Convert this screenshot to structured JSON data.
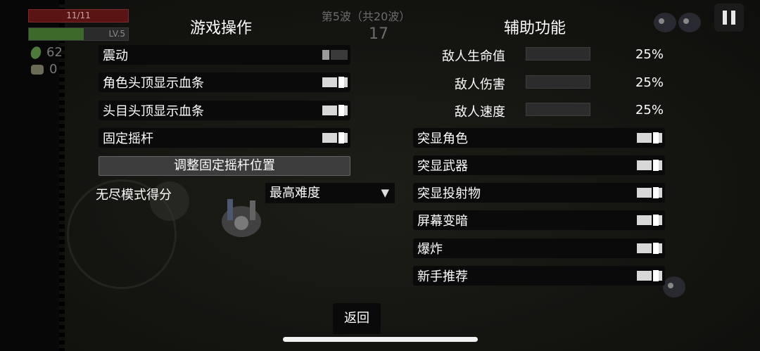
{
  "hud": {
    "hp_text": "11/11",
    "level_text": "LV.5",
    "gems": "62",
    "bags": "0",
    "wave": "第5波（共20波）",
    "timer": "17"
  },
  "controls": {
    "title": "游戏操作",
    "rows": [
      {
        "label": "震动",
        "state": "off"
      },
      {
        "label": "角色头顶显示血条",
        "state": "on"
      },
      {
        "label": "头目头顶显示血条",
        "state": "on"
      },
      {
        "label": "固定摇杆",
        "state": "on"
      }
    ],
    "adjust_button": "调整固定摇杆位置",
    "endless_label": "无尽模式得分",
    "difficulty_value": "最高难度",
    "difficulty_arrow": "▼"
  },
  "assist": {
    "title": "辅助功能",
    "sliders": [
      {
        "label": "敌人生命值",
        "value_text": "25%",
        "value": 0.0
      },
      {
        "label": "敌人伤害",
        "value_text": "25%",
        "value": 0.0
      },
      {
        "label": "敌人速度",
        "value_text": "25%",
        "value": 0.0
      }
    ],
    "toggles": [
      {
        "label": "突显角色",
        "state": "on"
      },
      {
        "label": "突显武器",
        "state": "on"
      },
      {
        "label": "突显投射物",
        "state": "on"
      },
      {
        "label": "屏幕变暗",
        "state": "on"
      },
      {
        "label": "爆炸",
        "state": "on"
      },
      {
        "label": "新手推荐",
        "state": "on"
      }
    ]
  },
  "back_label": "返回",
  "colors": {
    "hp": "#5a1414",
    "xp": "#3c6a2a",
    "toggle_on": "#d8d8d8",
    "toggle_off": "#3a3a3a"
  },
  "icons": {
    "pause": "pause-icon",
    "gem": "gem-icon",
    "bag": "bag-icon",
    "dropdown": "chevron-down-icon"
  }
}
